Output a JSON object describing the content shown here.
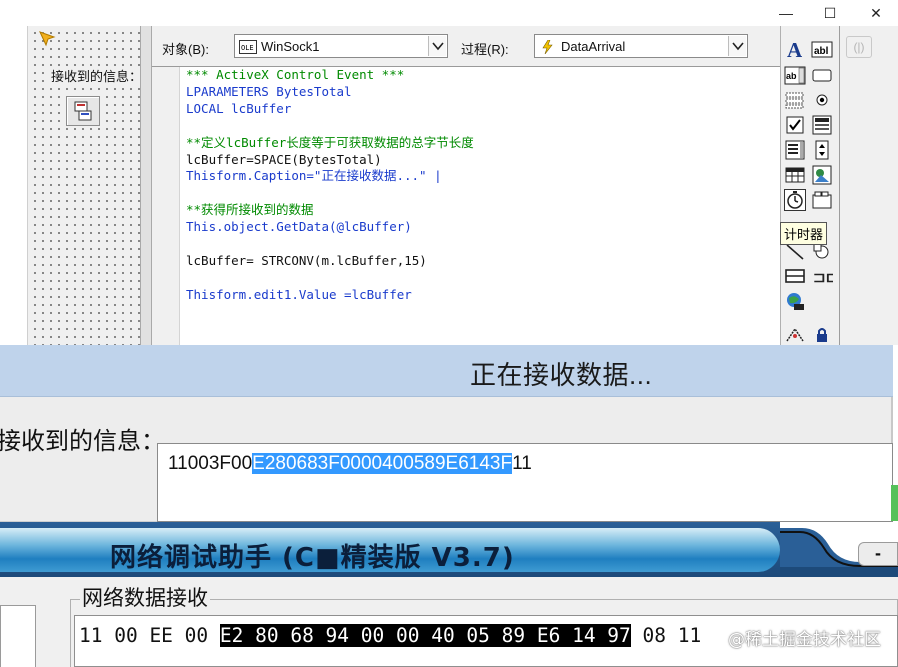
{
  "editor": {
    "window_controls": {
      "minimize": "—",
      "maximize": "☐",
      "close": "✕"
    },
    "form_designer": {
      "label": "接收到的信息："
    },
    "header": {
      "object_label": "对象(B):",
      "object_value": "WinSock1",
      "procedure_label": "过程(R):",
      "procedure_value": "DataArrival"
    },
    "code_lines": [
      "*** ActiveX Control Event ***",
      "LPARAMETERS BytesTotal",
      "LOCAL lcBuffer",
      "",
      "**定义lcBuffer长度等于可获取数据的总字节长度",
      "lcBuffer=SPACE(BytesTotal)",
      "Thisform.Caption=\"正在接收数据...\" |",
      "",
      "**获得所接收到的数据",
      "This.object.GetData(@lcBuffer)",
      "",
      "lcBuffer= STRCONV(m.lcBuffer,15)",
      "",
      "Thisform.edit1.Value =lcBuffer"
    ],
    "toolbox": {
      "tooltip": "计时器",
      "ghost_button": "(|)",
      "tools": [
        {
          "name": "label-tool",
          "icon": "label-icon"
        },
        {
          "name": "textbox-tool",
          "icon": "textbox-icon"
        },
        {
          "name": "editbox-tool",
          "icon": "editbox-icon"
        },
        {
          "name": "commandbutton-tool",
          "icon": "commandbutton-icon"
        },
        {
          "name": "listbox-tool",
          "icon": "listbox-icon"
        },
        {
          "name": "optiongroup-tool",
          "icon": "optiongroup-icon"
        },
        {
          "name": "checkbox-tool",
          "icon": "checkbox-icon"
        },
        {
          "name": "combobox-tool",
          "icon": "combobox-icon"
        },
        {
          "name": "list-tool",
          "icon": "list-icon"
        },
        {
          "name": "spinner-tool",
          "icon": "spinner-icon"
        },
        {
          "name": "grid-tool",
          "icon": "grid-icon"
        },
        {
          "name": "image-tool",
          "icon": "image-icon"
        },
        {
          "name": "timer-tool",
          "icon": "timer-icon"
        },
        {
          "name": "pageframe-tool",
          "icon": "pageframe-icon"
        },
        {
          "name": "line-tool",
          "icon": "line-icon"
        },
        {
          "name": "shape-tool",
          "icon": "shape-icon"
        },
        {
          "name": "container-tool",
          "icon": "container-icon"
        },
        {
          "name": "separator-tool",
          "icon": "separator-icon"
        },
        {
          "name": "hyperlink-tool",
          "icon": "hyperlink-icon"
        },
        {
          "name": "builder-lock-tool",
          "icon": "lock-icon"
        },
        {
          "name": "builder-tool",
          "icon": "builder-icon"
        }
      ]
    }
  },
  "running_form": {
    "caption": "正在接收数据...",
    "label": "接收到的信息：",
    "edit1": {
      "prefix": "11003F00",
      "selected": "E280683F0000400589E6143F",
      "suffix": "11"
    }
  },
  "net_assistant": {
    "title": "网络调试助手 (C■精装版 V3.7)",
    "minimize_label": "-",
    "group_label": "网络数据接收",
    "hex": {
      "prefix": "11 00 EE 00 ",
      "selected": "E2 80 68 94 00 00 40 05 89 E6 14 97",
      "suffix": " 08 11"
    },
    "watermark": "@稀土掘金技术社区"
  },
  "colors": {
    "title_blue": "#bfd3eb",
    "selection_blue": "#3399ff",
    "banner_blue": "#2a5f97",
    "code_green": "#008a00",
    "code_blue": "#1a3bcc"
  }
}
